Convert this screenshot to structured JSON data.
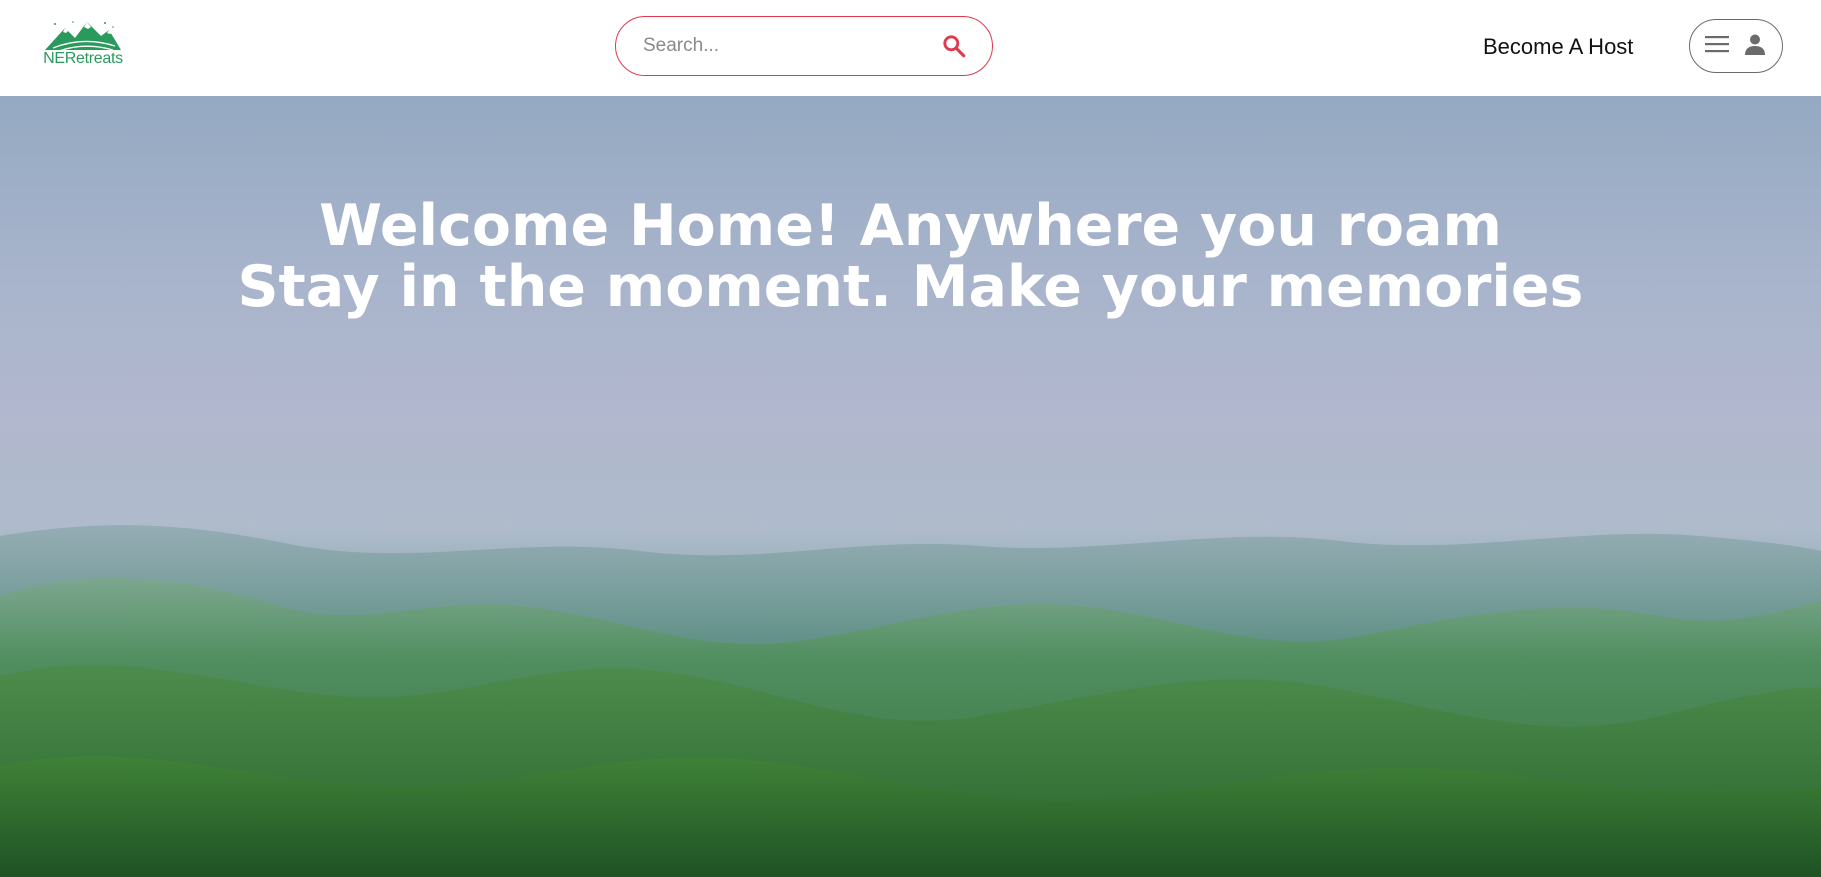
{
  "brand": {
    "name": "NERetreats",
    "logo_color": "#2a9a5c"
  },
  "search": {
    "placeholder": "Search...",
    "value": "",
    "icon": "search-icon",
    "accent_color": "#e0394f"
  },
  "nav": {
    "host_label": "Become A Host",
    "menu_icon": "hamburger-icon",
    "user_icon": "user-icon"
  },
  "hero": {
    "line1": "Welcome Home! Anywhere you roam",
    "line2": "Stay in the moment. Make your memories"
  }
}
